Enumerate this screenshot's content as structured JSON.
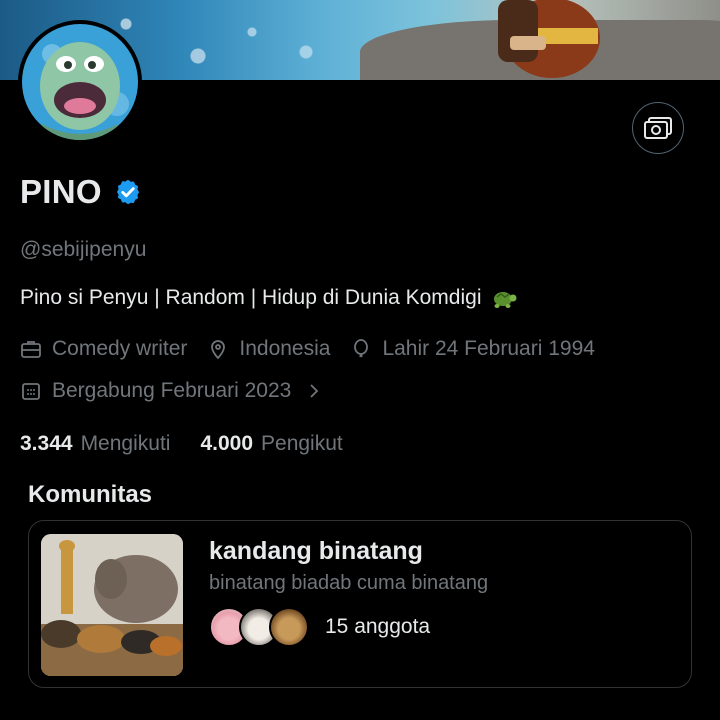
{
  "profile": {
    "name": "PINO",
    "handle": "@sebijipenyu",
    "bio": "Pino si Penyu | Random | Hidup di Dunia Komdigi",
    "bio_emoji_icon": "turtle-icon",
    "verified_icon": "verified-badge-icon"
  },
  "meta": {
    "job": "Comedy writer",
    "location": "Indonesia",
    "birth": "Lahir 24 Februari 1994",
    "joined": "Bergabung Februari 2023"
  },
  "stats": {
    "following_count": "3.344",
    "following_label": "Mengikuti",
    "followers_count": "4.000",
    "followers_label": "Pengikut"
  },
  "communities": {
    "title": "Komunitas",
    "items": [
      {
        "name": "kandang binatang",
        "description": "binatang biadab cuma binatang",
        "member_count": "15 anggota"
      }
    ]
  },
  "colors": {
    "background": "#000000",
    "primary_text": "#e7e9ea",
    "secondary_text": "#71767b",
    "verified_blue": "#1d9bf0",
    "border": "#2f3336"
  }
}
